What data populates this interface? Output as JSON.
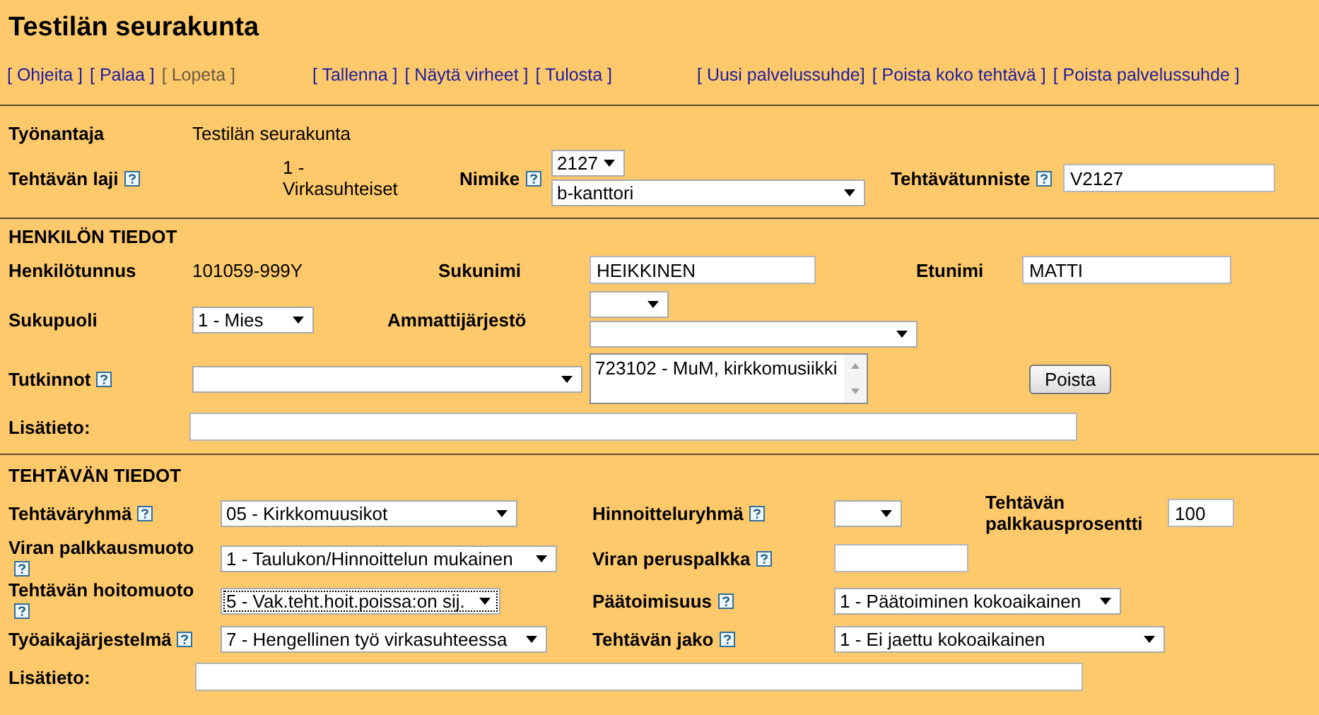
{
  "title": "Testilän seurakunta",
  "link_groups": [
    [
      {
        "label": "[ Ohjeita ]",
        "disabled": false
      },
      {
        "label": "[ Palaa ]",
        "disabled": false
      },
      {
        "label": "[ Lopeta ]",
        "disabled": true
      }
    ],
    [
      {
        "label": "[ Tallenna ]",
        "disabled": false
      },
      {
        "label": "[ Näytä virheet ]",
        "disabled": false
      },
      {
        "label": "[ Tulosta ]",
        "disabled": false
      }
    ],
    [
      {
        "label": "[ Uusi palvelussuhde]",
        "disabled": false
      },
      {
        "label": "[ Poista koko tehtävä ]",
        "disabled": false
      },
      {
        "label": "[ Poista palvelussuhde ]",
        "disabled": false
      }
    ]
  ],
  "sections": [
    {
      "rows": [
        [
          {
            "kind": "label",
            "text": "Työnantaja",
            "help": false
          },
          {
            "kind": "value",
            "text": "Testilän seurakunta"
          }
        ],
        [
          {
            "kind": "label",
            "text": "Tehtävän laji",
            "help": true
          },
          {
            "kind": "value",
            "text": "1 - Virkasuhteiset"
          },
          {
            "kind": "label",
            "text": "Nimike",
            "help": true
          },
          {
            "kind": "stack",
            "items": [
              {
                "kind": "select",
                "value": "2127"
              },
              {
                "kind": "select",
                "value": "b-kanttori"
              }
            ]
          },
          {
            "kind": "label",
            "text": "Tehtävätunniste",
            "help": true
          },
          {
            "kind": "input",
            "value": "V2127"
          }
        ]
      ]
    },
    {
      "heading": "HENKILÖN TIEDOT",
      "rows": [
        [
          {
            "kind": "label",
            "text": "Henkilötunnus",
            "help": false
          },
          {
            "kind": "value",
            "text": "101059-999Y"
          },
          {
            "kind": "label",
            "text": "Sukunimi",
            "help": false
          },
          {
            "kind": "input",
            "value": "HEIKKINEN"
          },
          {
            "kind": "label",
            "text": "Etunimi",
            "help": false
          },
          {
            "kind": "input",
            "value": "MATTI"
          }
        ],
        [
          {
            "kind": "label",
            "text": "Sukupuoli",
            "help": false
          },
          {
            "kind": "select",
            "value": "1 - Mies"
          },
          {
            "kind": "label",
            "text": "Ammattijärjestö",
            "help": false
          },
          {
            "kind": "stack",
            "items": [
              {
                "kind": "select"
              },
              {
                "kind": "select"
              }
            ]
          }
        ],
        [
          {
            "kind": "label",
            "text": "Tutkinnot",
            "help": true
          },
          {
            "kind": "select"
          },
          "",
          {
            "kind": "listbox",
            "items": [
              "723102 - MuM, kirkkomusiikki"
            ]
          },
          "",
          {
            "kind": "button",
            "label": "Poista"
          }
        ],
        [
          {
            "kind": "label",
            "text": "Lisätieto:",
            "help": false
          },
          {
            "kind": "input"
          }
        ]
      ]
    },
    {
      "heading": "TEHTÄVÄN TIEDOT",
      "rows": [
        [
          {
            "kind": "label",
            "text": "Tehtäväryhmä",
            "help": true
          },
          {
            "kind": "select",
            "value": "05 - Kirkkomuusikot"
          },
          {
            "kind": "label",
            "text": "Hinnoitteluryhmä",
            "help": true
          },
          {
            "kind": "select"
          },
          {
            "kind": "label",
            "text": "Tehtävän palkkausprosentti",
            "help": false
          },
          {
            "kind": "input",
            "value": "100"
          }
        ],
        [
          {
            "kind": "label",
            "text": "Viran palkkausmuoto",
            "help": true
          },
          {
            "kind": "select",
            "value": "1 - Taulukon/Hinnoittelun mukainen"
          },
          {
            "kind": "label",
            "text": "Viran peruspalkka",
            "help": true
          },
          {
            "kind": "input"
          }
        ],
        [
          {
            "kind": "label",
            "text": "Tehtävän hoitomuoto",
            "help": true
          },
          {
            "kind": "select",
            "value": "5 - Vak.teht.hoit.poissa:on sij.",
            "focused": true
          },
          {
            "kind": "label",
            "text": "Päätoimisuus",
            "help": true
          },
          {
            "kind": "select",
            "value": "1 - Päätoiminen kokoaikainen"
          }
        ],
        [
          {
            "kind": "label",
            "text": "Työaikajärjestelmä",
            "help": true
          },
          {
            "kind": "select",
            "value": "7 - Hengellinen työ virkasuhteessa"
          },
          {
            "kind": "label",
            "text": "Tehtävän jako",
            "help": true
          },
          {
            "kind": "select",
            "value": "1 - Ei jaettu kokoaikainen"
          }
        ],
        [
          {
            "kind": "label",
            "text": "Lisätieto:",
            "help": false
          },
          {
            "kind": "input"
          }
        ]
      ]
    }
  ]
}
